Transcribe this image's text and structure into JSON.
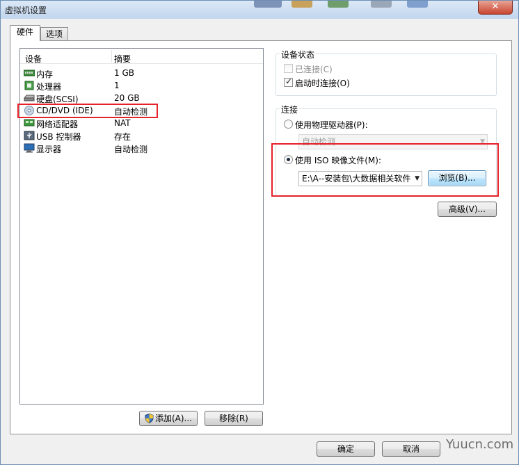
{
  "window": {
    "title": "虚拟机设置"
  },
  "tabs": [
    {
      "label": "硬件",
      "active": true
    },
    {
      "label": "选项",
      "active": false
    }
  ],
  "device_list": {
    "columns": [
      "设备",
      "摘要"
    ],
    "rows": [
      {
        "icon": "memory-icon",
        "name": "内存",
        "summary": "1 GB"
      },
      {
        "icon": "processor-icon",
        "name": "处理器",
        "summary": "1"
      },
      {
        "icon": "hard-disk-icon",
        "name": "硬盘(SCSI)",
        "summary": "20 GB"
      },
      {
        "icon": "cd-dvd-icon",
        "name": "CD/DVD (IDE)",
        "summary": "自动检测",
        "selected": true
      },
      {
        "icon": "network-adapter-icon",
        "name": "网络适配器",
        "summary": "NAT"
      },
      {
        "icon": "usb-icon",
        "name": "USB 控制器",
        "summary": "存在"
      },
      {
        "icon": "display-icon",
        "name": "显示器",
        "summary": "自动检测"
      }
    ]
  },
  "device_status": {
    "label": "设备状态",
    "connected": {
      "label": "已连接(C)",
      "checked": false,
      "enabled": false
    },
    "connect_at_power_on": {
      "label": "启动时连接(O)",
      "checked": true,
      "enabled": true
    }
  },
  "connection": {
    "label": "连接",
    "physical_drive": {
      "label": "使用物理驱动器(P):",
      "selected": false,
      "value": "自动检测"
    },
    "iso_image": {
      "label": "使用 ISO 映像文件(M):",
      "selected": true,
      "value": "E:\\A--安装包\\大数据相关软件"
    },
    "browse_label": "浏览(B)..."
  },
  "advanced_label": "高级(V)...",
  "add_label": "添加(A)...",
  "remove_label": "移除(R)",
  "ok_label": "确定",
  "cancel_label": "取消",
  "watermark": "Yuucn.com",
  "colors": {
    "highlight": "#e6212a",
    "title_bar": "#c2d6ee",
    "close": "#c8452f"
  }
}
